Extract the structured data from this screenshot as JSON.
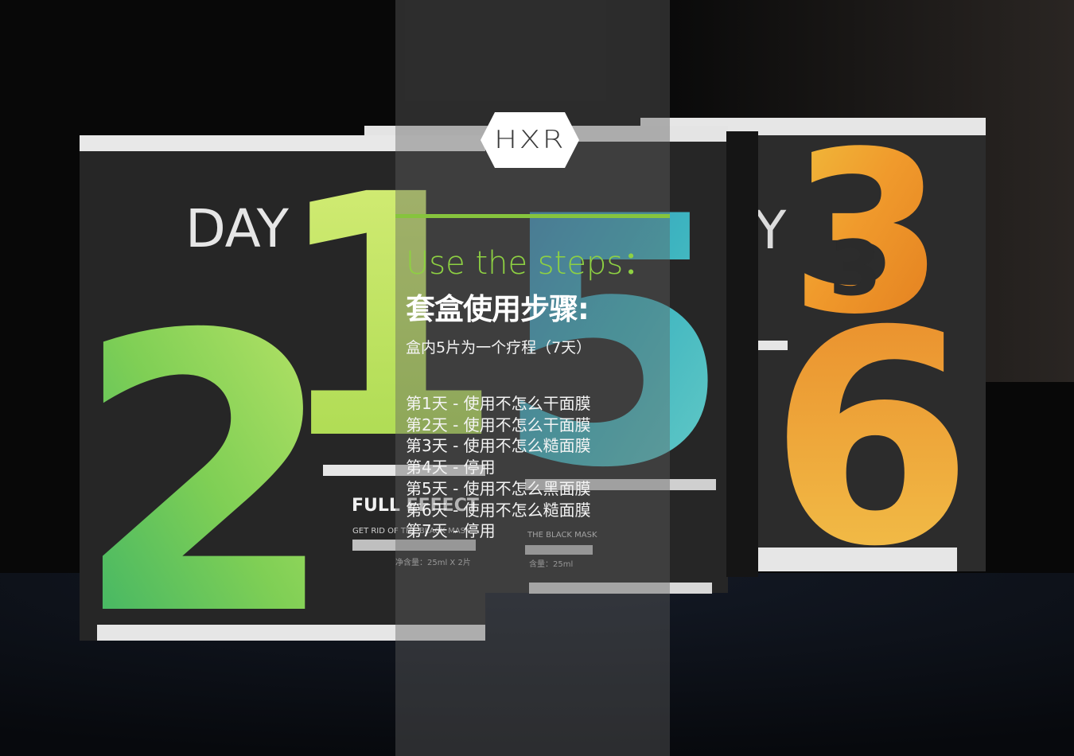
{
  "logo": {
    "text": "HXR"
  },
  "boxes": [
    {
      "label": "DAY",
      "digit_front": "2",
      "digit_back": "1",
      "brand_line": "FULL EFFECT",
      "sub_line": "GET RID OF THE BLACK MASK",
      "net": "净含量：25ml X 2片"
    },
    {
      "digit_back": "5",
      "sub_line": "THE BLACK MASK",
      "net": "含量：25ml"
    },
    {
      "label_fragment": "Y",
      "digit_back": "3",
      "digit_front": "6"
    }
  ],
  "overlay": {
    "heading_en": "Use the steps：",
    "heading_cn": "套盒使用步骤:",
    "course": "盒内5片为一个疗程（7天）",
    "steps": [
      "第1天 - 使用不怎么干面膜",
      "第2天 - 使用不怎么干面膜",
      "第3天 - 使用不怎么糙面膜",
      "第4天 - 停用",
      "第5天 - 使用不怎么黑面膜",
      "第6天 - 使用不怎么糙面膜",
      "第7天 - 停用"
    ]
  },
  "colors": {
    "accent_green": "#86c43d",
    "overlay": "#5f5f5f",
    "background": "#070707"
  }
}
